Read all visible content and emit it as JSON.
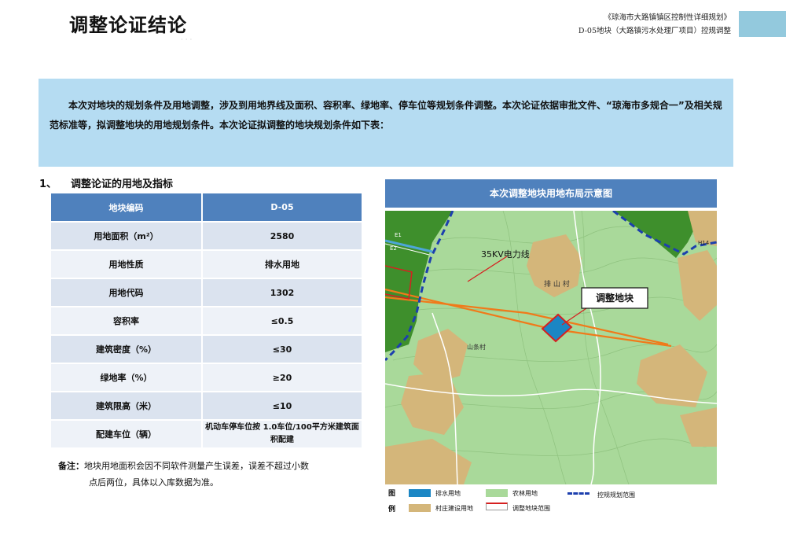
{
  "header": {
    "page_title": "调整论证结论",
    "title_ghost": "· ·  ·",
    "doc_title": "《琼海市大路镇镇区控制性详细规划》",
    "doc_subtitle": "D-05地块（大路镇污水处理厂项目）控规调整"
  },
  "intro": {
    "text": "本次对地块的规划条件及用地调整，涉及到用地界线及面积、容积率、绿地率、停车位等规划条件调整。本次论证依据审批文件、“琼海市多规合一”及相关规范标准等，拟调整地块的用地规划条件。本次论证拟调整的地块规划条件如下表："
  },
  "section": {
    "number": "1、",
    "title": "调整论证的用地及指标"
  },
  "table": {
    "header_label": "地块编码",
    "header_value": "D-05",
    "rows": [
      {
        "label": "用地面积（m²）",
        "value": "2580"
      },
      {
        "label": "用地性质",
        "value": "排水用地"
      },
      {
        "label": "用地代码",
        "value": "1302"
      },
      {
        "label": "容积率",
        "value": "≤0.5"
      },
      {
        "label": "建筑密度（%）",
        "value": "≤30"
      },
      {
        "label": "绿地率（%）",
        "value": "≥20"
      },
      {
        "label": "建筑限高（米）",
        "value": "≤10"
      },
      {
        "label": "配建车位（辆）",
        "value": "机动车停车位按 1.0车位/100平方米建筑面积配建"
      }
    ]
  },
  "note": {
    "label": "备注：",
    "line1": "地块用地面积会因不同软件测量产生误差，误差不超过小数",
    "line2": "点后两位，具体以入库数据为准。"
  },
  "map": {
    "title": "本次调整地块用地布局示意图",
    "labels": {
      "power_line": "35KV电力线",
      "village_1": "排 山 村",
      "village_2": "山条村",
      "adjust_parcel": "调整地块",
      "e1": "E1",
      "e2": "E2",
      "h14": "H14"
    },
    "colors": {
      "forest": "#a9d99a",
      "village": "#d4b67a",
      "green_dark": "#3e8f2c",
      "drainage": "#1b86c4",
      "power_line": "#f07a1a",
      "boundary": "#1c3fae",
      "adjust_outline": "#d62020"
    }
  },
  "legend": {
    "head_1": "图",
    "head_2": "例",
    "items": [
      {
        "label": "排水用地",
        "color": "#1b86c4"
      },
      {
        "label": "农林用地",
        "color": "#a9d99a"
      },
      {
        "label": "控规规划范围",
        "color": "#1c3fae"
      },
      {
        "label": "村庄建设用地",
        "color": "#d4b67a"
      },
      {
        "label": "调整地块范围",
        "color": "#d62020"
      }
    ]
  }
}
